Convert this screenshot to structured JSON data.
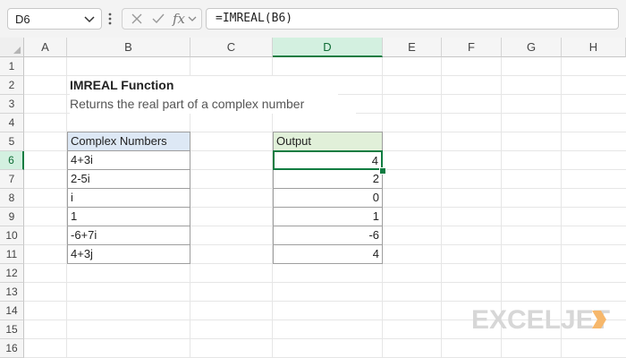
{
  "formula_bar": {
    "name_box": "D6",
    "formula": "=IMREAL(B6)",
    "fx_label": "fx"
  },
  "columns": [
    "A",
    "B",
    "C",
    "D",
    "E",
    "F",
    "G",
    "H"
  ],
  "selected_column": "D",
  "rows": [
    "1",
    "2",
    "3",
    "4",
    "5",
    "6",
    "7",
    "8",
    "9",
    "10",
    "11",
    "12",
    "13",
    "14",
    "15",
    "16"
  ],
  "selected_row": "6",
  "sheet": {
    "title": "IMREAL Function",
    "subtitle": "Returns the real part of a complex number",
    "table": {
      "header_input": "Complex Numbers",
      "header_output": "Output",
      "inputs": [
        "4+3i",
        "2-5i",
        "i",
        "1",
        "-6+7i",
        "4+3j"
      ],
      "outputs": [
        "4",
        "2",
        "0",
        "1",
        "-6",
        "4"
      ]
    }
  },
  "logo": {
    "text": "EXCELJET"
  },
  "colors": {
    "accent_green": "#107c41",
    "header_blue": "#dde8f5",
    "header_green": "#e1f0d9",
    "logo_gray": "#d7d7d7",
    "logo_orange": "#f6b76b"
  },
  "icons": {
    "name_box_dropdown": "chevron-down-icon",
    "cancel": "x-icon",
    "enter": "check-icon",
    "function": "fx-icon",
    "function_dropdown": "chevron-down-icon",
    "more": "vertical-dots-icon",
    "select_all": "triangle-icon"
  }
}
